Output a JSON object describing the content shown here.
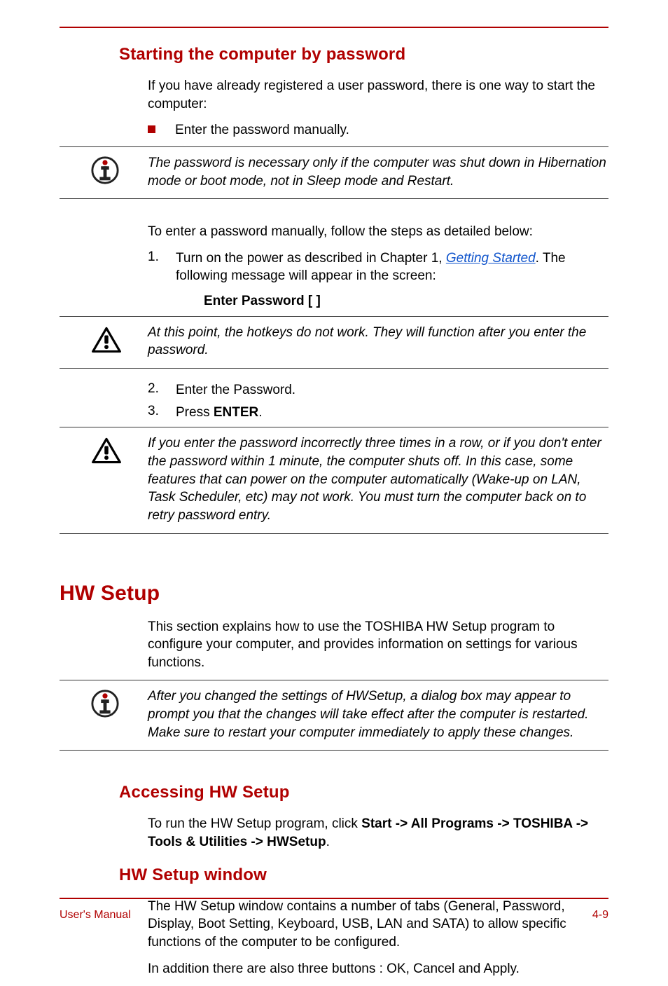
{
  "header_rule": true,
  "footer": {
    "left": "User's Manual",
    "right": "4-9"
  },
  "section1": {
    "heading": "Starting the computer by password",
    "intro": "If you have already registered a user password, there is one way to start the computer:",
    "bullet1": "Enter the password manually.",
    "note1": "The password is necessary only if the computer was shut down in Hibernation mode or boot mode, not in Sleep mode and Restart.",
    "pre_steps": "To enter a password manually, follow the steps as detailed below:",
    "step1_pre": "Turn on the power as described in Chapter 1, ",
    "step1_link": "Getting Started",
    "step1_post": ". The following message will appear in the screen:",
    "step1_code": "Enter Password [ ]",
    "note2": "At this point, the hotkeys do not work. They will function after you enter the password.",
    "step2": "Enter the Password.",
    "step3_pre": "Press ",
    "step3_bold": "ENTER",
    "step3_post": ".",
    "note3": "If you enter the password incorrectly three times in a row, or if you don't enter the password within 1 minute, the computer shuts off. In this case, some features that can power on the computer automatically (Wake-up on LAN, Task Scheduler, etc) may not work. You must turn the computer back on to retry password entry."
  },
  "section2": {
    "heading": "HW Setup",
    "intro": "This section explains how to use the TOSHIBA HW Setup program to configure your computer, and provides information on settings for various functions.",
    "note1": "After you changed the settings of HWSetup, a dialog box may appear to prompt you that the changes will take effect after the computer is restarted. Make sure to restart your computer immediately to apply these changes.",
    "sub1_heading": "Accessing HW Setup",
    "sub1_text_pre": "To run the HW Setup program, click ",
    "sub1_text_bold": "Start -> All Programs -> TOSHIBA -> Tools & Utilities -> HWSetup",
    "sub1_text_post": ".",
    "sub2_heading": "HW Setup window",
    "sub2_p1": "The HW Setup window contains a number of tabs (General, Password, Display, Boot Setting, Keyboard, USB, LAN and SATA) to allow specific functions of the computer to be configured.",
    "sub2_p2": "In addition there are also three buttons : OK, Cancel and Apply."
  }
}
